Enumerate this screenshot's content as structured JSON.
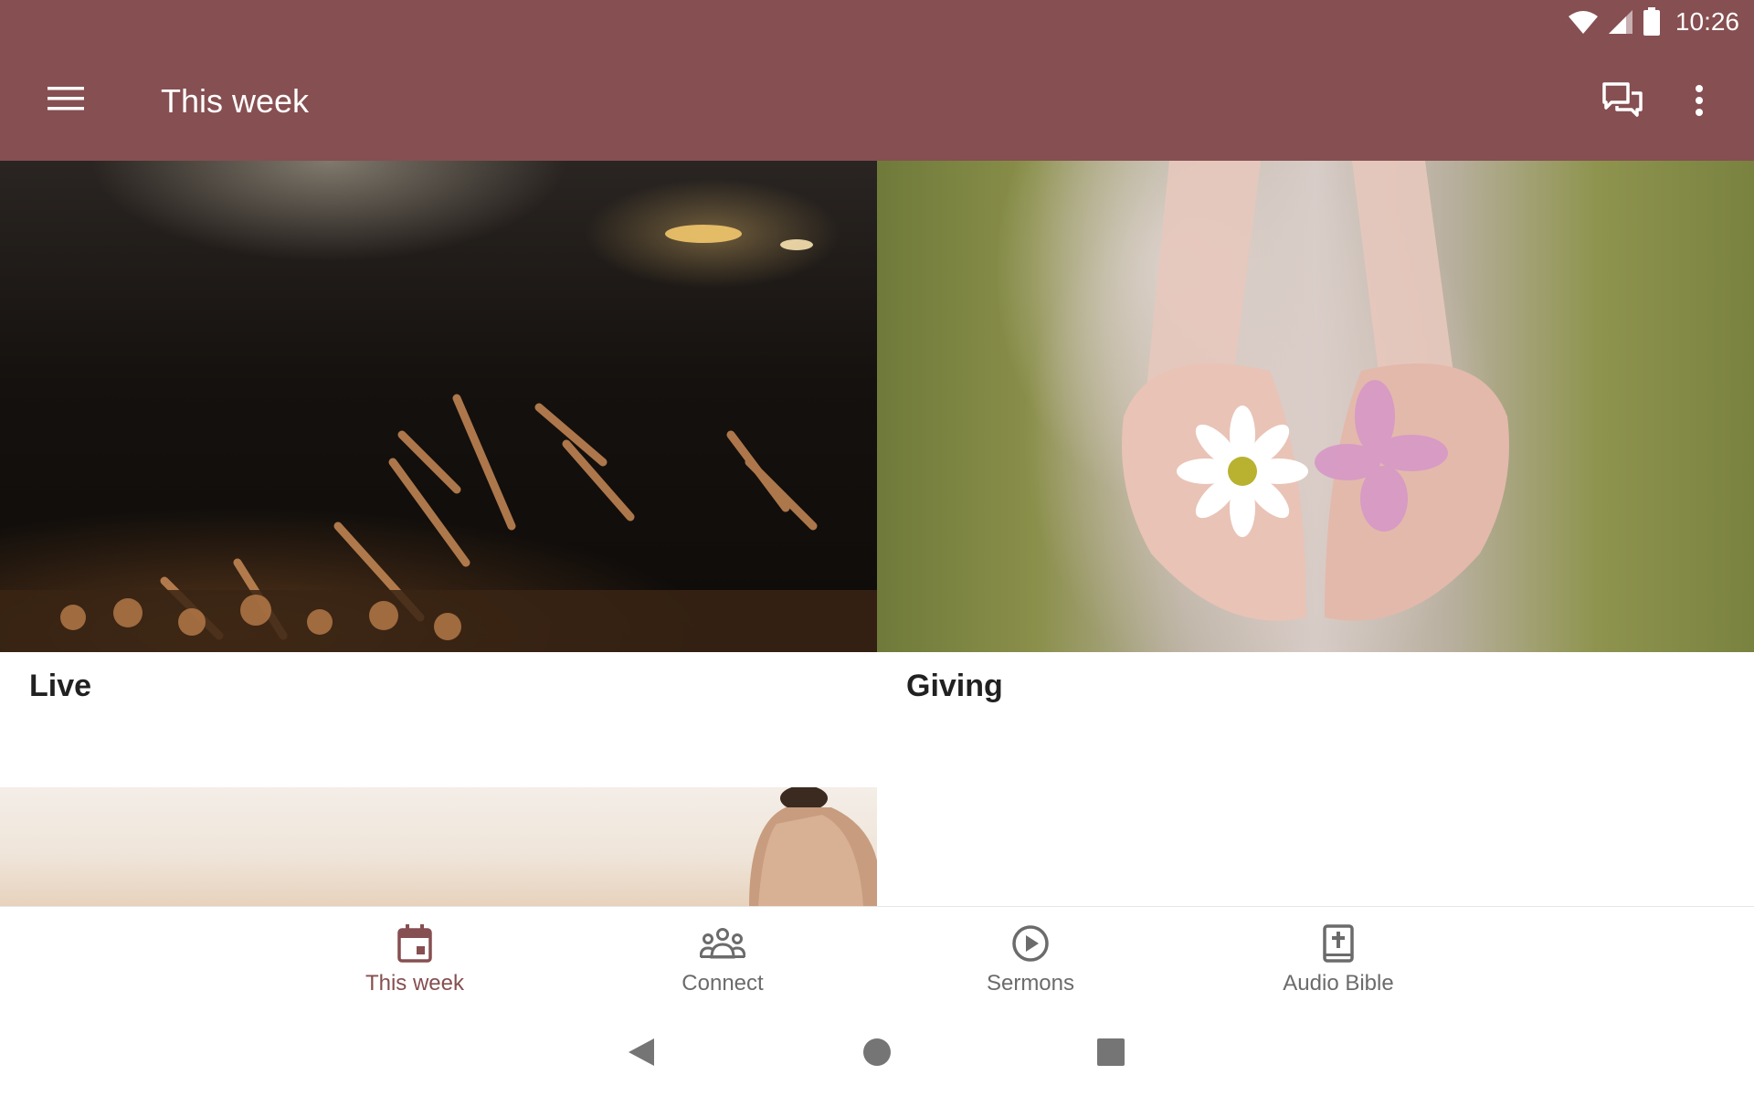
{
  "status_bar": {
    "time": "10:26",
    "icons": [
      "wifi-icon",
      "cell-signal-icon",
      "battery-icon"
    ]
  },
  "app_bar": {
    "title": "This week",
    "menu_icon": "hamburger-menu-icon",
    "chat_icon": "chat-icon",
    "overflow_icon": "more-vert-icon",
    "background_color": "#864f51",
    "text_color": "#ffffff"
  },
  "cards": [
    {
      "title": "Live",
      "image": "worship-concert-hands-raised"
    },
    {
      "title": "Giving",
      "image": "hands-holding-flowers"
    },
    {
      "title": "",
      "image": "person-at-sunset"
    }
  ],
  "bottom_nav": {
    "items": [
      {
        "label": "This week",
        "icon": "calendar-icon",
        "active": true
      },
      {
        "label": "Connect",
        "icon": "group-icon",
        "active": false
      },
      {
        "label": "Sermons",
        "icon": "play-circle-icon",
        "active": false
      },
      {
        "label": "Audio Bible",
        "icon": "bible-icon",
        "active": false
      }
    ],
    "active_color": "#864f51",
    "inactive_color": "#6b6b6b"
  },
  "system_nav": {
    "icons": [
      "back-icon",
      "home-icon",
      "recents-icon"
    ]
  }
}
